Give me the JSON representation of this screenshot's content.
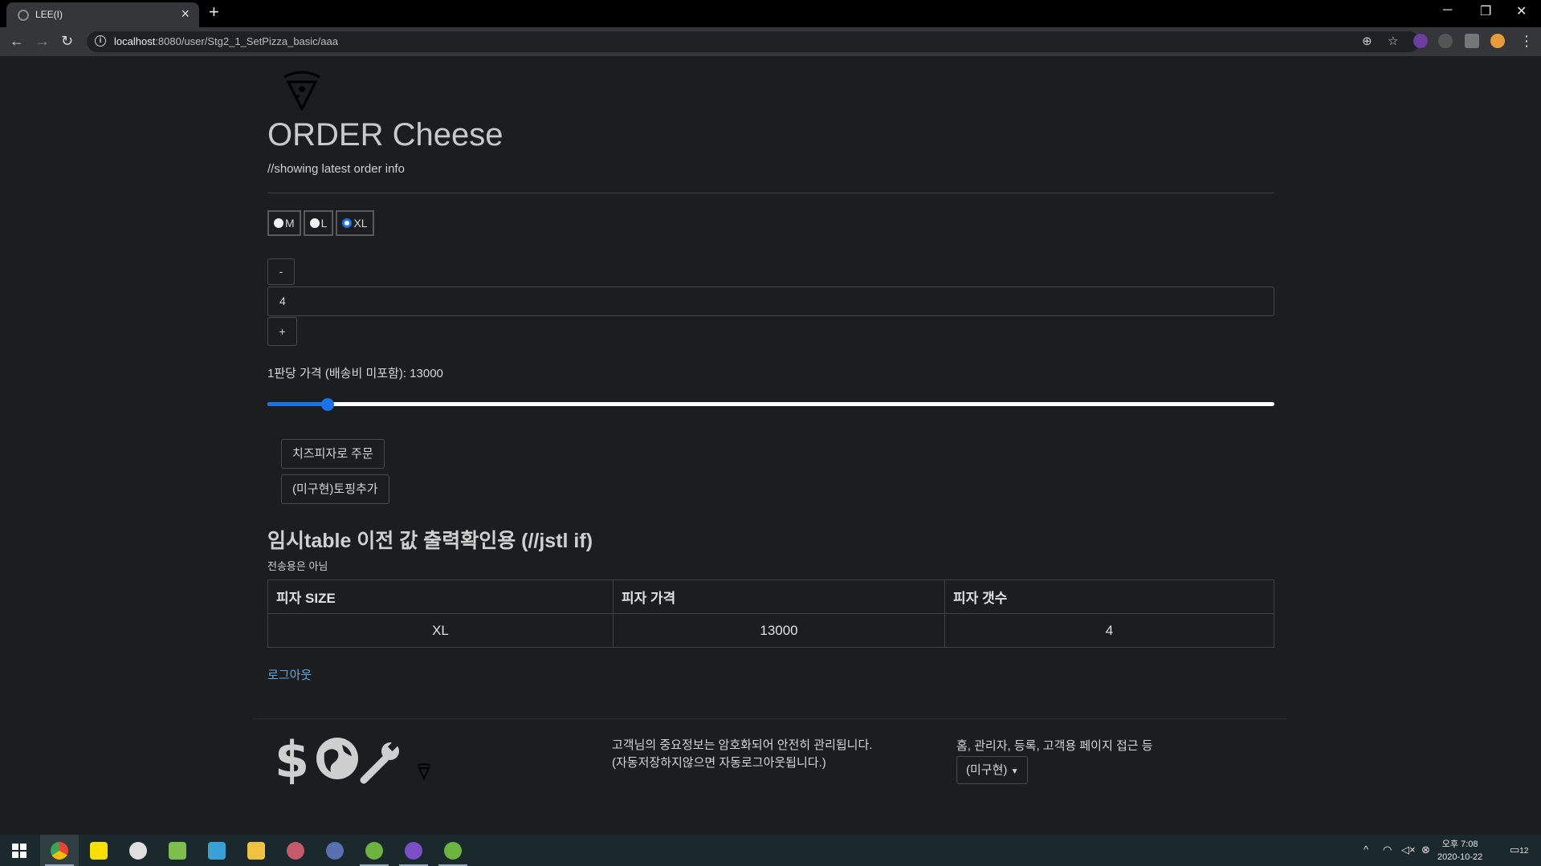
{
  "browser": {
    "tab_title": "LEE(I)",
    "tab_close": "×",
    "new_tab": "+",
    "url_host": "localhost",
    "url_path": ":8080/user/Stg2_1_SetPizza_basic/aaa",
    "window_controls": {
      "minimize": "─",
      "restore": "❐",
      "close": "✕"
    }
  },
  "page": {
    "title": "ORDER Cheese",
    "subtitle": "//showing latest order info",
    "sizes": [
      {
        "label": "M",
        "checked": false
      },
      {
        "label": "L",
        "checked": false
      },
      {
        "label": "XL",
        "checked": true
      }
    ],
    "qty_minus": "-",
    "qty_value": "4",
    "qty_plus": "+",
    "price_label": "1판당 가격 (배송비 미포함): 13000",
    "price_slider_fraction": 0.06,
    "order_button": "치즈피자로 주문",
    "topping_button": "(미구현)토핑추가",
    "table_heading": "임시table 이전 값 출력확인용 (//jstl if)",
    "table_note": "전송용은 아님",
    "table_headers": [
      "피자 SIZE",
      "피자 가격",
      "피자 갯수"
    ],
    "table_rows": [
      [
        "XL",
        "13000",
        "4"
      ]
    ],
    "logout": "로그아웃"
  },
  "footer": {
    "security_line1": "고객님의 중요정보는 암호화되어 안전히 관리됩니다.",
    "security_line2": "(자동저장하지않으면 자동로그아웃됩니다.)",
    "nav_text": "홈, 관리자, 등록, 고객용 페이지 접근 등",
    "dropdown_label": "(미구현)"
  },
  "taskbar": {
    "clock_time": "오후 7:08",
    "clock_date": "2020-10-22",
    "notification_count": "12"
  },
  "colors": {
    "accent": "#1a73e8",
    "link": "#5aa9e6",
    "background": "#1c1d1f"
  }
}
